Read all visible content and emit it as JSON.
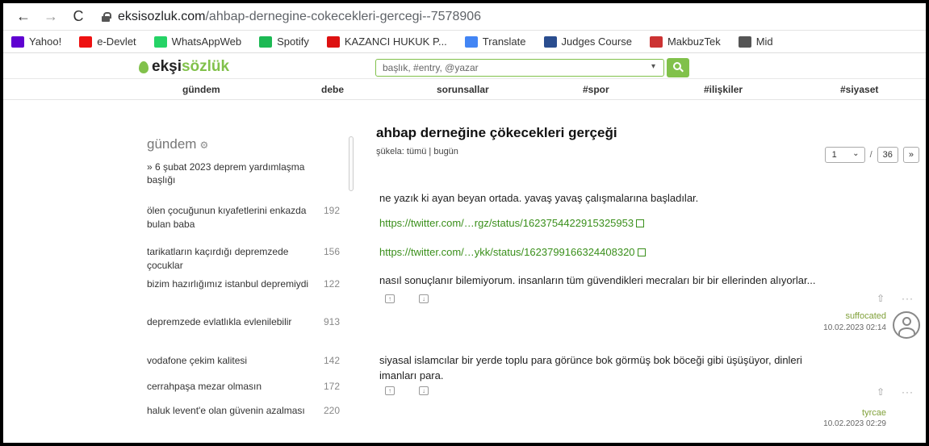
{
  "browser": {
    "url_host": "eksisozluk.com",
    "url_path": "/ahbap-dernegine-cokecekleri-gercegi--7578906",
    "bookmarks": [
      {
        "label": "Yahoo!",
        "icon": "yahoo-icon",
        "color": "#5f01d1"
      },
      {
        "label": "e-Devlet",
        "icon": "edevlet-icon",
        "color": "#e11"
      },
      {
        "label": "WhatsAppWeb",
        "icon": "whatsapp-icon",
        "color": "#25d366"
      },
      {
        "label": "Spotify",
        "icon": "spotify-icon",
        "color": "#1db954"
      },
      {
        "label": "KAZANCI HUKUK P...",
        "icon": "kazanci-icon",
        "color": "#d11"
      },
      {
        "label": "Translate",
        "icon": "translate-icon",
        "color": "#4285f4"
      },
      {
        "label": "Judges Course",
        "icon": "judges-icon",
        "color": "#2a4d8f"
      },
      {
        "label": "MakbuzTek",
        "icon": "makbuztek-icon",
        "color": "#c33"
      },
      {
        "label": "Mid",
        "icon": "mid-icon",
        "color": "#555"
      }
    ]
  },
  "site": {
    "logo_prefix": "ekşi",
    "logo_brand": "sözlük",
    "search_placeholder": "başlık, #entry, @yazar",
    "accent": "#81c14b",
    "nav": [
      "gündem",
      "debe",
      "sorunsallar",
      "#spor",
      "#ilişkiler",
      "#siyaset"
    ]
  },
  "sidebar": {
    "title": "gündem",
    "pinned": "» 6 şubat 2023 deprem yardımlaşma başlığı",
    "topics": [
      {
        "title": "ölen çocuğunun kıyafetlerini enkazda bulan baba",
        "count": "192"
      },
      {
        "title": "tarikatların kaçırdığı depremzede çocuklar",
        "count": "156"
      },
      {
        "title": "bizim hazırlığımız istanbul depremiydi",
        "count": "122"
      },
      {
        "title": "depremzede evlatlıkla evlenilebilir",
        "count": "913"
      },
      {
        "title": "vodafone çekim kalitesi",
        "count": "142"
      },
      {
        "title": "cerrahpaşa mezar olmasın",
        "count": "172"
      },
      {
        "title": "haluk levent'e olan güvenin azalması",
        "count": "220"
      }
    ]
  },
  "topic": {
    "title": "ahbap derneğine çökecekleri gerçeği",
    "sukela": "şükela:  tümü | bugün",
    "page_current": "1",
    "page_sep": "/",
    "page_total": "36",
    "page_next": "»"
  },
  "entries": [
    {
      "line1": "ne yazık ki ayan beyan ortada. yavaş yavaş çalışmalarına başladılar.",
      "link1": "https://twitter.com/…rgz/status/1623754422915325953",
      "link2": "https://twitter.com/…ykk/status/1623799166324408320",
      "line2": "nasıl sonuçlanır bilemiyorum. insanların tüm güvendikleri mecraları bir bir ellerinden alıyorlar...",
      "author": "suffocated",
      "date": "10.02.2023 02:14"
    },
    {
      "line1": "siyasal islamcılar bir yerde toplu para görünce bok görmüş bok böceği gibi üşüşüyor, dinleri",
      "line2": "imanları para.",
      "author": "tyrcae",
      "date": "10.02.2023 02:29"
    }
  ]
}
